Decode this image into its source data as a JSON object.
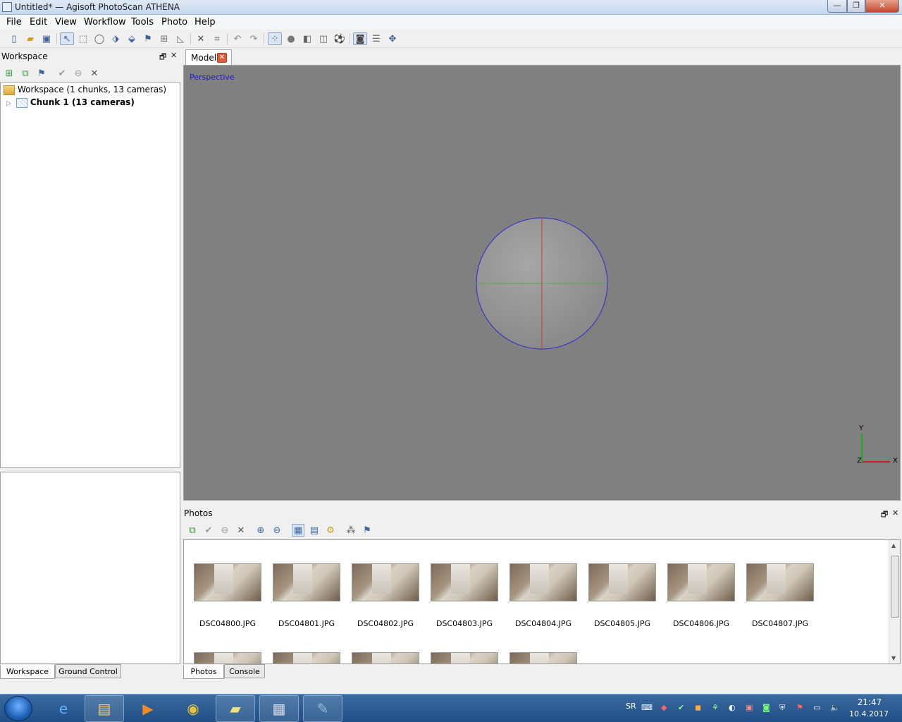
{
  "window": {
    "title": "Untitled* — Agisoft PhotoScan ATHENA",
    "minimize": "—",
    "maximize": "❐",
    "close": "✕"
  },
  "menu": [
    "File",
    "Edit",
    "View",
    "Workflow",
    "Tools",
    "Photo",
    "Help"
  ],
  "workspace": {
    "title": "Workspace",
    "restore": "🗗",
    "close": "✕",
    "root_label": "Workspace (1 chunks, 13 cameras)",
    "chunk_label": "Chunk 1 (13 cameras)",
    "tabs": [
      "Workspace",
      "Ground Control"
    ]
  },
  "model": {
    "tab_label": "Model",
    "tab_close": "✕",
    "view_mode": "Perspective",
    "axis_y": "Y",
    "axis_x": "X",
    "axis_z": "Z"
  },
  "photos": {
    "title": "Photos",
    "restore": "🗗",
    "close": "✕",
    "items": [
      "DSC04800.JPG",
      "DSC04801.JPG",
      "DSC04802.JPG",
      "DSC04803.JPG",
      "DSC04804.JPG",
      "DSC04805.JPG",
      "DSC04806.JPG",
      "DSC04807.JPG"
    ],
    "tabs": [
      "Photos",
      "Console"
    ]
  },
  "taskbar": {
    "language": "SR",
    "time": "21:47",
    "date": "10.4.2017"
  },
  "colors": {
    "viewport_bg": "#808080",
    "perspective_text": "#1b1bcc",
    "close_button": "#c4472c"
  }
}
